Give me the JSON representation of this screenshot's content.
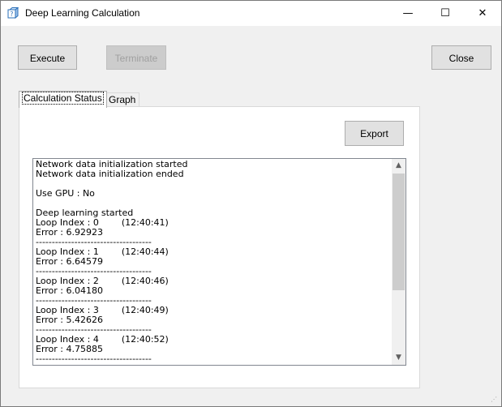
{
  "window": {
    "title": "Deep Learning Calculation",
    "minimize_glyph": "—",
    "maximize_glyph": "☐",
    "close_glyph": "✕"
  },
  "toolbar": {
    "execute_label": "Execute",
    "terminate_label": "Terminate",
    "close_label": "Close"
  },
  "tabs": [
    {
      "label": "Calculation Status",
      "selected": true
    },
    {
      "label": "Graph",
      "selected": false
    }
  ],
  "panel": {
    "export_label": "Export"
  },
  "log": {
    "lines": [
      "Network data initialization started",
      "Network data initialization ended",
      "",
      "Use GPU : No",
      "",
      "Deep learning started",
      "Loop Index : 0        (12:40:41)",
      "Error : 6.92923",
      "------------------------------------",
      "Loop Index : 1        (12:40:44)",
      "Error : 6.64579",
      "------------------------------------",
      "Loop Index : 2        (12:40:46)",
      "Error : 6.04180",
      "------------------------------------",
      "Loop Index : 3        (12:40:49)",
      "Error : 5.42626",
      "------------------------------------",
      "Loop Index : 4        (12:40:52)",
      "Error : 4.75885",
      "------------------------------------"
    ]
  },
  "icons": {
    "scroll_up": "up-arrow-icon",
    "scroll_down": "down-arrow-icon"
  }
}
